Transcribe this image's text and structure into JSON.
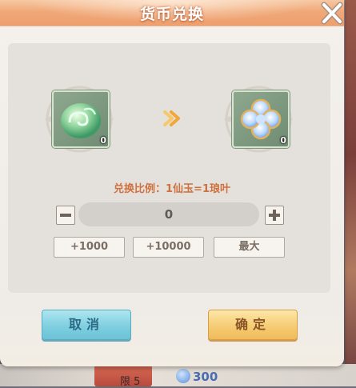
{
  "dialog": {
    "title": "货币兑换",
    "close_icon": "close-x-icon"
  },
  "exchange": {
    "from_item": {
      "icon": "jade-cloud-icon",
      "count": "0"
    },
    "arrow_icon": "double-chevron-right-icon",
    "to_item": {
      "icon": "clover-leaf-icon",
      "count": "0"
    },
    "ratio_text": "兑换比例：1仙玉=1琅叶"
  },
  "amount": {
    "decrement_icon": "minus-icon",
    "value": "0",
    "increment_icon": "plus-icon"
  },
  "quick_buttons": [
    "+1000",
    "+10000",
    "最大"
  ],
  "actions": {
    "cancel_label": "取消",
    "confirm_label": "确定"
  },
  "background": {
    "card_text": "限 5",
    "currency_icon": "blue-gem-icon",
    "currency_value": "300"
  },
  "colors": {
    "title_bar": "#f0a878",
    "ratio_text": "#d0703c",
    "cancel_button": "#7fcfe0",
    "confirm_button": "#f6cc74"
  }
}
